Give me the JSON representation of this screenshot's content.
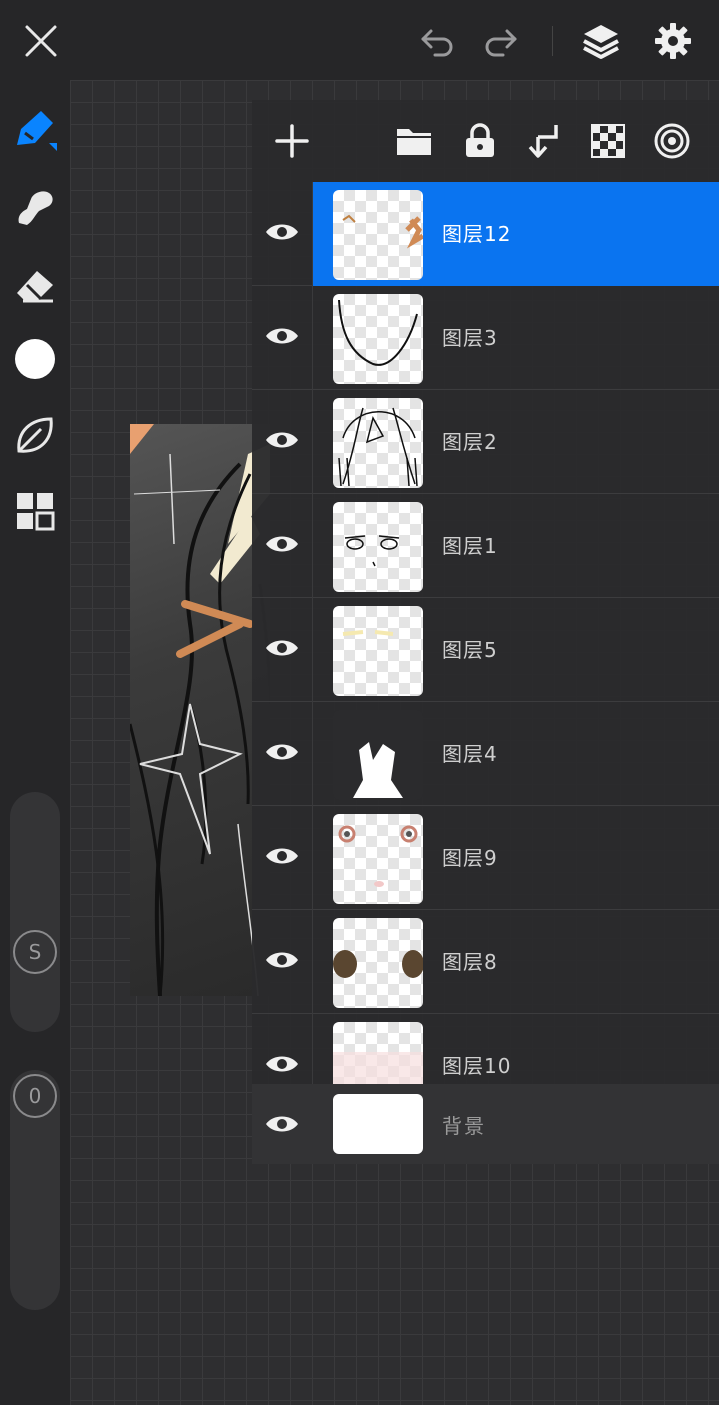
{
  "colors": {
    "accent": "#0a74f0",
    "background": "#2a2a2c",
    "toolbar": "#262628"
  },
  "topbar": {
    "icons": [
      "close-icon",
      "undo-icon",
      "redo-icon",
      "layers-icon",
      "settings-icon"
    ]
  },
  "toolbar": {
    "tools": [
      "brush-icon",
      "smudge-icon",
      "eraser-icon",
      "color-swatch",
      "leaf-icon",
      "grid-menu-icon"
    ],
    "size_slider_label": "S",
    "opacity_slider_label": "0"
  },
  "layers_panel": {
    "header_icons": [
      "add-layer-icon",
      "folder-icon",
      "lock-icon",
      "merge-down-icon",
      "alpha-lock-icon",
      "reference-icon"
    ],
    "layers": [
      {
        "name": "图层12",
        "selected": true
      },
      {
        "name": "图层3",
        "selected": false
      },
      {
        "name": "图层2",
        "selected": false
      },
      {
        "name": "图层1",
        "selected": false
      },
      {
        "name": "图层5",
        "selected": false
      },
      {
        "name": "图层4",
        "selected": false
      },
      {
        "name": "图层9",
        "selected": false
      },
      {
        "name": "图层8",
        "selected": false
      },
      {
        "name": "图层10",
        "selected": false
      }
    ],
    "background_layer": {
      "name": "背景"
    }
  }
}
